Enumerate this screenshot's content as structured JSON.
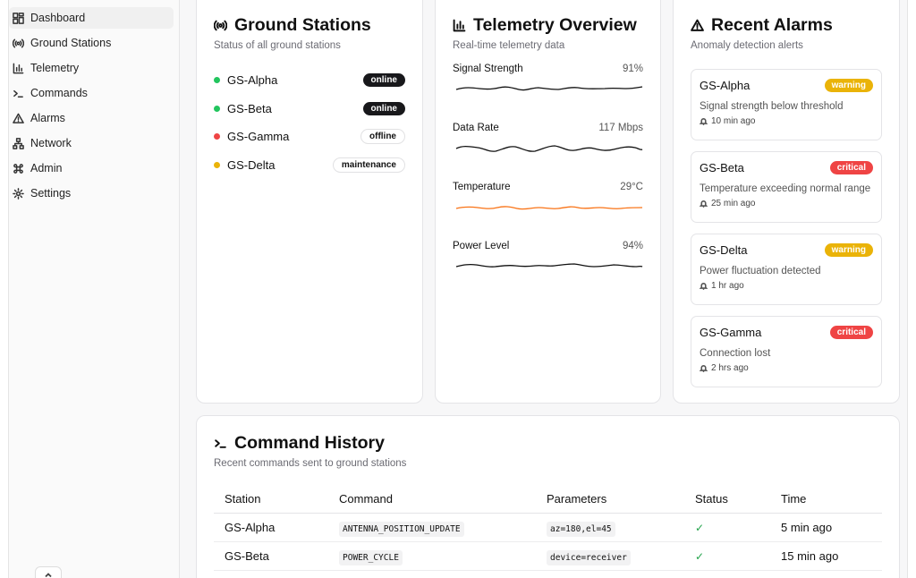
{
  "sidebar": {
    "items": [
      {
        "label": "Dashboard",
        "icon": "dashboard-icon",
        "active": true
      },
      {
        "label": "Ground Stations",
        "icon": "radio-icon"
      },
      {
        "label": "Telemetry",
        "icon": "bar-chart-icon"
      },
      {
        "label": "Commands",
        "icon": "terminal-icon"
      },
      {
        "label": "Alarms",
        "icon": "alert-triangle-icon"
      },
      {
        "label": "Network",
        "icon": "network-icon"
      },
      {
        "label": "Admin",
        "icon": "command-key-icon"
      },
      {
        "label": "Settings",
        "icon": "gear-icon"
      }
    ]
  },
  "stations": {
    "title": "Ground Stations",
    "subtitle": "Status of all ground stations",
    "items": [
      {
        "name": "GS-Alpha",
        "status": "online",
        "dot_color": "#22c55e"
      },
      {
        "name": "GS-Beta",
        "status": "online",
        "dot_color": "#22c55e"
      },
      {
        "name": "GS-Gamma",
        "status": "offline",
        "dot_color": "#ef4444"
      },
      {
        "name": "GS-Delta",
        "status": "maintenance",
        "dot_color": "#eab308"
      }
    ]
  },
  "telemetry": {
    "title": "Telemetry Overview",
    "subtitle": "Real-time telemetry data",
    "metrics": [
      {
        "label": "Signal Strength",
        "value": "91%",
        "color": "#111111"
      },
      {
        "label": "Data Rate",
        "value": "117 Mbps",
        "color": "#111111"
      },
      {
        "label": "Temperature",
        "value": "29°C",
        "color": "#f97316"
      },
      {
        "label": "Power Level",
        "value": "94%",
        "color": "#111111"
      }
    ]
  },
  "alarms": {
    "title": "Recent Alarms",
    "subtitle": "Anomaly detection alerts",
    "items": [
      {
        "station": "GS-Alpha",
        "severity": "warning",
        "message": "Signal strength below threshold",
        "time": "10 min ago"
      },
      {
        "station": "GS-Beta",
        "severity": "critical",
        "message": "Temperature exceeding normal range",
        "time": "25 min ago"
      },
      {
        "station": "GS-Delta",
        "severity": "warning",
        "message": "Power fluctuation detected",
        "time": "1 hr ago"
      },
      {
        "station": "GS-Gamma",
        "severity": "critical",
        "message": "Connection lost",
        "time": "2 hrs ago"
      }
    ]
  },
  "commands": {
    "title": "Command History",
    "subtitle": "Recent commands sent to ground stations",
    "headers": [
      "Station",
      "Command",
      "Parameters",
      "Status",
      "Time"
    ],
    "rows": [
      {
        "station": "GS-Alpha",
        "command": "ANTENNA_POSITION_UPDATE",
        "params": "az=180,el=45",
        "status": "✓",
        "time": "5 min ago"
      },
      {
        "station": "GS-Beta",
        "command": "POWER_CYCLE",
        "params": "device=receiver",
        "status": "✓",
        "time": "15 min ago"
      }
    ]
  },
  "colors": {
    "online": "#22c55e",
    "offline": "#ef4444",
    "maintenance": "#eab308",
    "warning": "#eab308",
    "critical": "#ef4444"
  }
}
